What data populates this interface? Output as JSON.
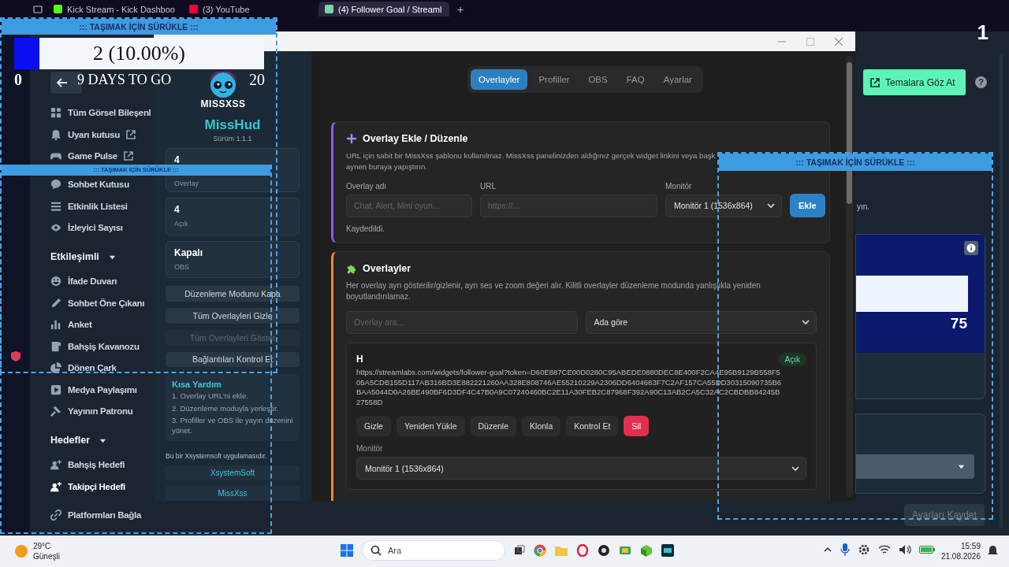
{
  "browser_tabs": [
    {
      "title": "Kick Stream - Kick Dashboo",
      "selected": false
    },
    {
      "title": "(3) YouTube",
      "selected": false
    },
    {
      "title": "(4) Follower Goal / Streaml",
      "selected": true
    }
  ],
  "new_tab": "+",
  "corner_count": "1",
  "dashboard_nav": {
    "sections": [
      {
        "items": [
          {
            "label": "Tüm Görsel Bileşenl",
            "external": false,
            "selected": false
          },
          {
            "label": "Uyarı kutusu",
            "external": true,
            "selected": false
          },
          {
            "label": "Game Pulse",
            "external": true,
            "selected": false
          }
        ]
      },
      {
        "items": [
          {
            "label": "Sohbet Kutusu",
            "external": false,
            "selected": false
          },
          {
            "label": "Etkinlik Listesi",
            "external": false,
            "selected": false
          },
          {
            "label": "İzleyici Sayısı",
            "external": false,
            "selected": false
          }
        ]
      },
      {
        "title": "Etkileşimli",
        "expanded": true,
        "items": [
          {
            "label": "İfade Duvarı",
            "external": false,
            "selected": false
          },
          {
            "label": "Sohbet Öne Çıkanı",
            "external": false,
            "selected": false
          },
          {
            "label": "Anket",
            "external": false,
            "selected": false
          },
          {
            "label": "Bahşiş Kavanozu",
            "external": false,
            "selected": false
          },
          {
            "label": "Dönen Çark",
            "external": false,
            "selected": false
          },
          {
            "label": "Medya Paylaşımı",
            "external": false,
            "selected": false
          },
          {
            "label": "Yayının Patronu",
            "external": false,
            "selected": false
          }
        ]
      },
      {
        "title": "Hedefler",
        "expanded": true,
        "items": [
          {
            "label": "Bahşiş Hedefi",
            "external": false,
            "selected": false
          },
          {
            "label": "Takipçi Hedefi",
            "external": false,
            "selected": true
          }
        ]
      },
      {
        "items": [
          {
            "label": "Platformları Bağla",
            "external": false,
            "selected": false
          }
        ]
      }
    ]
  },
  "goal_overlay": {
    "drag_label": "::: TAŞIMAK İÇİN SÜRÜKLE :::",
    "progress": "2 (10.00%)",
    "level": 0.1,
    "start": "0",
    "countdown": "9 DAYS TO GO",
    "goal": "20"
  },
  "second_overlay": {
    "drag_label": "::: TAŞIMAK İÇİN SÜRÜKLE :::"
  },
  "misshud": {
    "sidebar": {
      "logo_text": "MISSXSS",
      "app_name": "MissHud",
      "version": "Sürüm 1.1.1",
      "stats": [
        {
          "value": "4",
          "label": "Overlay"
        },
        {
          "value": "4",
          "label": "Açık"
        },
        {
          "value": "Kapalı",
          "label": "OBS"
        }
      ],
      "actions": [
        {
          "label": "Düzenleme Modunu Kapa",
          "disabled": false
        },
        {
          "label": "Tüm Overlayleri Gizle",
          "disabled": false
        },
        {
          "label": "Tüm Overlayleri Göster",
          "disabled": true
        },
        {
          "label": "Bağlantıları Kontrol Et",
          "disabled": false
        }
      ],
      "help": {
        "title": "Kısa Yardım",
        "steps": [
          "1. Overlay URL'ni ekle.",
          "2. Düzenleme moduyla yerleştir.",
          "3. Profiller ve OBS ile yayın düzenini yönet."
        ]
      },
      "credit": "Bu bir Xsystemsoft uygulamasıdır.",
      "links": [
        "XsystemSoft",
        "MissXss"
      ]
    },
    "tabs": [
      {
        "label": "Overlayler",
        "selected": true
      },
      {
        "label": "Profiller",
        "selected": false
      },
      {
        "label": "OBS",
        "selected": false
      },
      {
        "label": "FAQ",
        "selected": false
      },
      {
        "label": "Ayarlar",
        "selected": false
      }
    ],
    "add_card": {
      "title": "Overlay Ekle / Düzenle",
      "description_lines": [
        "URL için sabit bir MissXss şablonu kullanılmaz. MissXss panelinizden aldığınız gerçek widget linkini veya başk",
        "aynen buraya yapıştırın."
      ],
      "fields": [
        {
          "label": "Overlay adı",
          "placeholder": "Chat, Alert, Mini oyun..."
        },
        {
          "label": "URL",
          "placeholder": "https://..."
        }
      ],
      "monitor": {
        "label": "Monitör",
        "value": "Monitör 1 (1536x864)"
      },
      "add_button": "Ekle",
      "status": "Kaydedildi."
    },
    "list_card": {
      "title": "Overlayler",
      "description": "Her overlay ayrı gösterilir/gizlenir, ayrı ses ve zoom değeri alır. Kilitli overlayler düzenleme modunda yanlışlıkla yeniden boyutlandırılamaz.",
      "search": {
        "placeholder": "Overlay ara..."
      },
      "sort": {
        "value": "Ada göre"
      },
      "items": [
        {
          "name": "H",
          "status": "Açık",
          "url": "https://streamlabs.com/widgets/follower-goal?token=D60E887CE00D0280C95ABEDE0880DEC8E400F2CA4E95B9129B558F505A5CDB155D117AB316BD3E882221260AA328E808746AE55210229A2306DD6404683F7C2AF157CA55DD30315090735B6BAA5044D0A26BE490BF6D3DF4C47B0A9C07240460BC2E11A30FEB2C87968F392A90C13AB2CA5C32AC2CBDBB84245B27558D",
          "actions": [
            {
              "label": "Gizle",
              "kind": "normal"
            },
            {
              "label": "Yeniden Yükle",
              "kind": "normal"
            },
            {
              "label": "Düzenle",
              "kind": "normal"
            },
            {
              "label": "Klonla",
              "kind": "normal"
            },
            {
              "label": "Kontrol Et",
              "kind": "normal"
            },
            {
              "label": "Sil",
              "kind": "danger"
            }
          ],
          "monitor": {
            "label": "Monitör",
            "value": "Monitör 1 (1536x864)"
          }
        }
      ]
    }
  },
  "right_overlay": {
    "drag_label": "::: TAŞIMAK İÇİN SÜRÜKLE :::"
  },
  "dashboard_right": {
    "themes_button": "Temalara Göz At",
    "help_label": "?",
    "fragment": "yın.",
    "goal_value": "75",
    "save_button": "Ayarları Kaydet"
  },
  "taskbar": {
    "temperature": "29°C",
    "weather": "Güneşli",
    "search_placeholder": "Ara",
    "time": "15:59",
    "date": "21.08.2026"
  }
}
